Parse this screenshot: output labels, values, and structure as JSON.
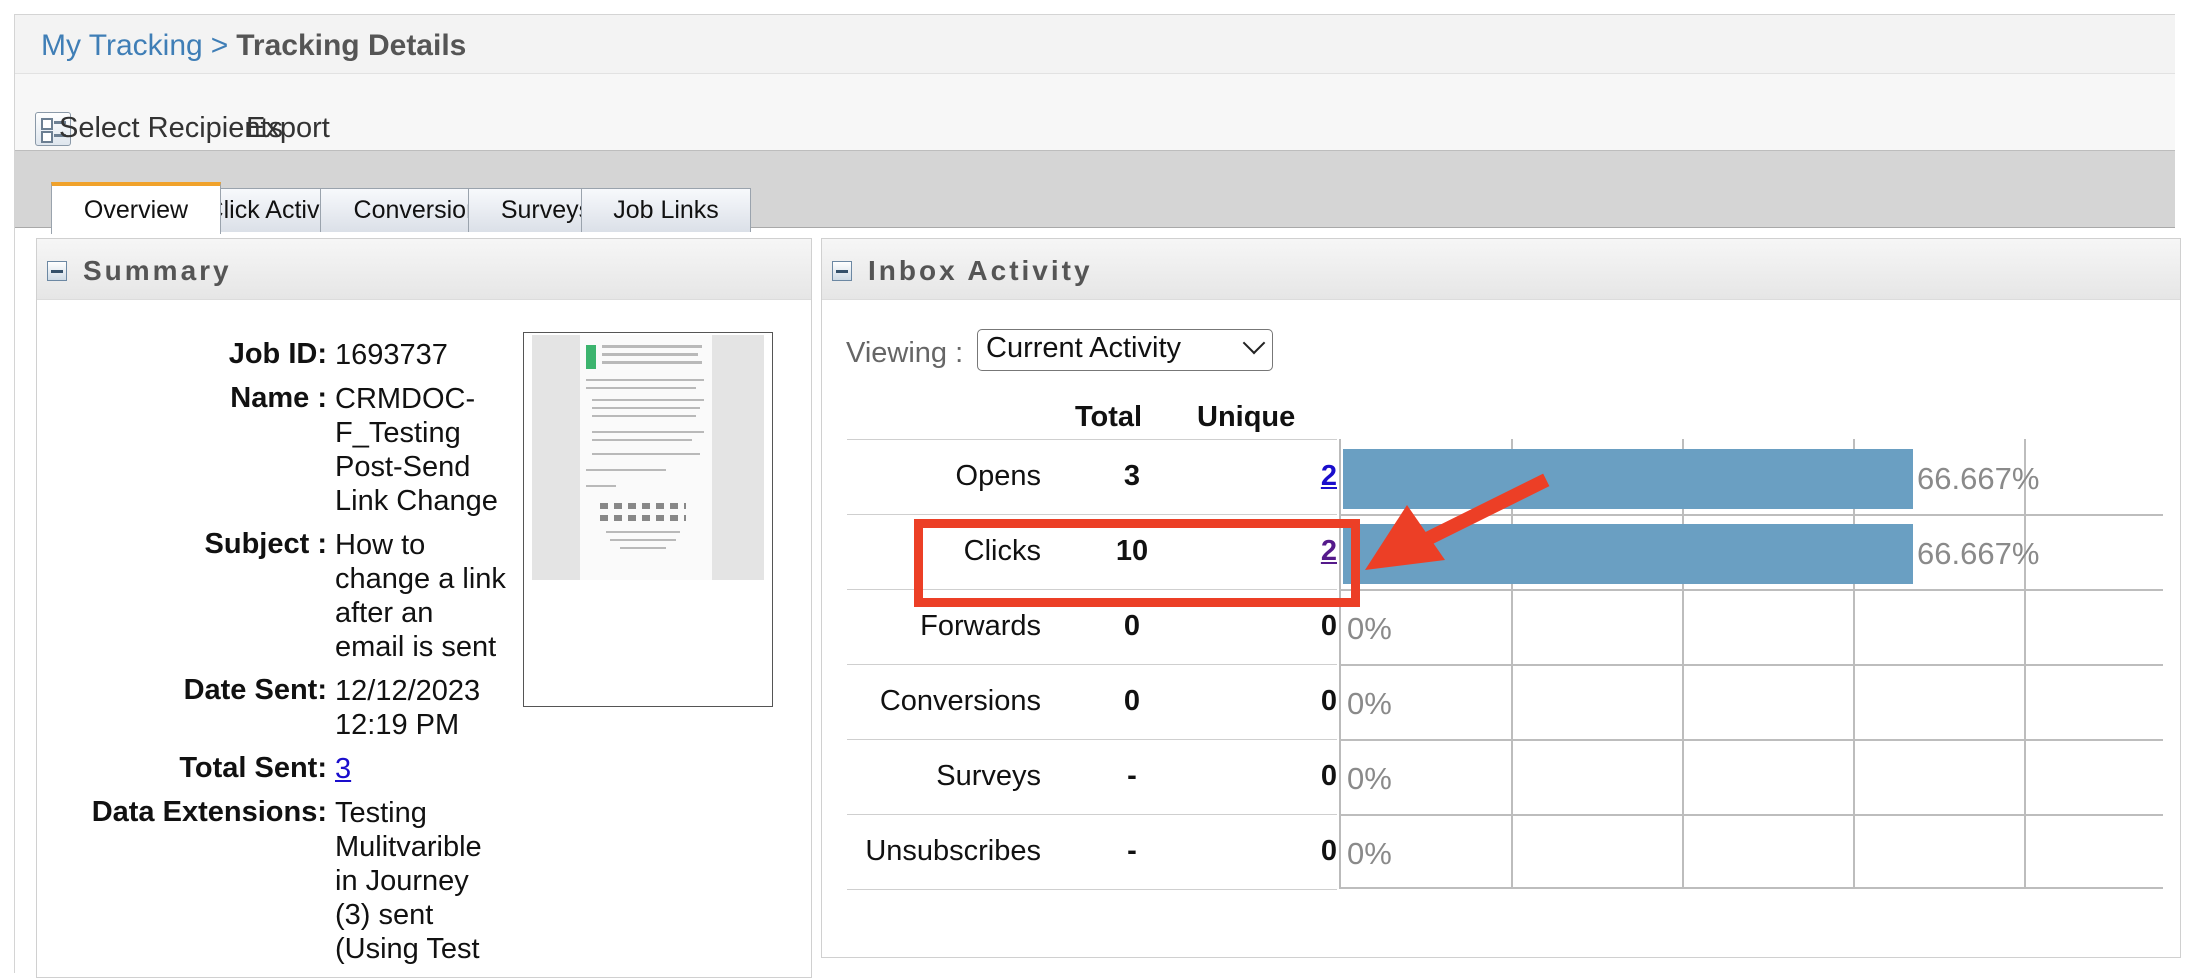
{
  "breadcrumb": {
    "parent": "My Tracking",
    "separator": ">",
    "current": "Tracking Details"
  },
  "toolbar": {
    "select_recipients": "Select Recipients",
    "export": "Export"
  },
  "tabs": [
    {
      "label": "Overview",
      "active": true
    },
    {
      "label": "Click Activity"
    },
    {
      "label": "Conversions"
    },
    {
      "label": "Surveys"
    },
    {
      "label": "Job Links"
    }
  ],
  "summary": {
    "title": "Summary",
    "job_id_label": "Job ID:",
    "job_id": "1693737",
    "name_label": "Name :",
    "name": "CRMDOC-F_Testing Post-Send Link Change",
    "subject_label": "Subject :",
    "subject": "How to change a link after an email is sent",
    "date_sent_label": "Date Sent:",
    "date_sent": "12/12/2023 12:19 PM",
    "total_sent_label": "Total Sent:",
    "total_sent": "3",
    "data_ext_label": "Data Extensions:",
    "data_ext": "Testing Mulitvarible in Journey (3) sent (Using Test"
  },
  "inbox": {
    "title": "Inbox Activity",
    "viewing_label": "Viewing :",
    "viewing_value": "Current Activity",
    "col_total": "Total",
    "col_unique": "Unique",
    "rows": [
      {
        "label": "Opens",
        "total": "3",
        "unique": "2",
        "pct": "66.667%",
        "fraction": 0.66667
      },
      {
        "label": "Clicks",
        "total": "10",
        "unique": "2",
        "pct": "66.667%",
        "fraction": 0.66667
      },
      {
        "label": "Forwards",
        "total": "0",
        "unique": "0",
        "pct": "0%",
        "fraction": 0
      },
      {
        "label": "Conversions",
        "total": "0",
        "unique": "0",
        "pct": "0%",
        "fraction": 0
      },
      {
        "label": "Surveys",
        "total": "-",
        "unique": "0",
        "pct": "0%",
        "fraction": 0
      },
      {
        "label": "Unsubscribes",
        "total": "-",
        "unique": "0",
        "pct": "0%",
        "fraction": 0
      }
    ]
  },
  "colors": {
    "accent_tab": "#f0a22b",
    "bar": "#6a9fc2",
    "callout": "#ec3f26",
    "link": "#3f7eb6"
  }
}
